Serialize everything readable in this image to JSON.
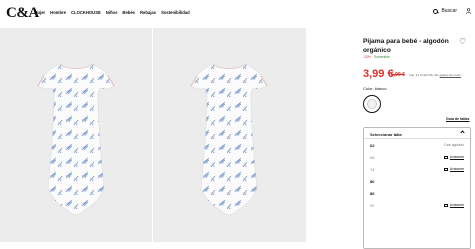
{
  "header": {
    "logo": "C&A",
    "nav": [
      "Mujer",
      "Hombre",
      "CLOCKHOUSE",
      "Niños",
      "Bebés",
      "Rebajas",
      "Sostenibilidad"
    ],
    "search_label": "Buscar"
  },
  "product": {
    "title": "Pijama para bebé - algodón orgánico",
    "discount": "-33%",
    "sustainability": "Sostenible",
    "price": "3,99 €",
    "old_price": "5,99 €",
    "vat_note": "Imp. 21 % del IVA. Sin",
    "vat_link": "gastos de envío",
    "color_label": "Color: blanco",
    "size_guide": "Guía de tallas",
    "select_label": "Seleccionar talla",
    "sizes": [
      {
        "value": "62",
        "status": "Casi agotado",
        "notify": ""
      },
      {
        "value": "68",
        "status": "",
        "notify": "Avisarme"
      },
      {
        "value": "74",
        "status": "",
        "notify": "Avisarme"
      },
      {
        "value": "80",
        "status": "",
        "notify": ""
      },
      {
        "value": "86",
        "status": "",
        "notify": ""
      },
      {
        "value": "92",
        "status": "",
        "notify": "Avisarme"
      }
    ]
  },
  "colors": {
    "accent_red": "#e0302b",
    "sustainable_green": "#2c8a3c",
    "photo_bg": "#ececec",
    "print_blue": "#6f8fc8"
  }
}
